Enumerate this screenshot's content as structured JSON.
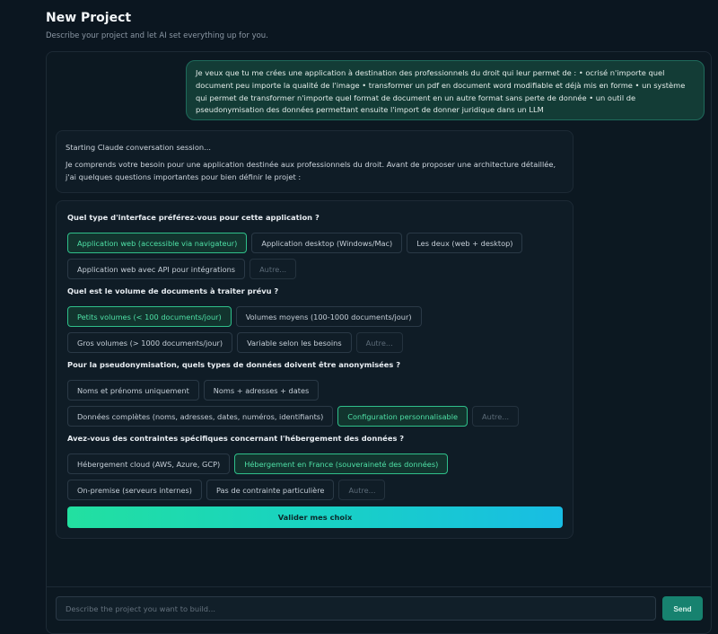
{
  "header": {
    "title": "New Project",
    "subtitle": "Describe your project and let AI set everything up for you."
  },
  "user_message": "Je veux que tu me crées une application à destination des professionnels du droit qui leur permet de : • ocrisé n'importe quel document peu importe la qualité de l'image • transformer un pdf en document word modifiable et déjà mis en forme • un système qui permet de transformer n'importe quel format de document en un autre format sans perte de donnée • un outil de pseudonymisation des données permettant ensuite l'import de donner juridique dans un LLM",
  "assistant_message": {
    "session": "Starting Claude conversation session...",
    "text": "Je comprends votre besoin pour une application destinée aux professionnels du droit. Avant de proposer une architecture détaillée, j'ai quelques questions importantes pour bien définir le projet :"
  },
  "questions": [
    {
      "label": "Quel type d'interface préférez-vous pour cette application ?",
      "row1": [
        "Application web (accessible via navigateur)",
        "Application desktop (Windows/Mac)",
        "Les deux (web + desktop)"
      ],
      "row2": [
        "Application web avec API pour intégrations",
        "Autre..."
      ]
    },
    {
      "label": "Quel est le volume de documents à traiter prévu ?",
      "row1": [
        "Petits volumes (< 100 documents/jour)",
        "Volumes moyens (100-1000 documents/jour)"
      ],
      "row2": [
        "Gros volumes (> 1000 documents/jour)",
        "Variable selon les besoins",
        "Autre..."
      ]
    },
    {
      "label": "Pour la pseudonymisation, quels types de données doivent être anonymisées ?",
      "row1": [
        "Noms et prénoms uniquement",
        "Noms + adresses + dates"
      ],
      "row2": [
        "Données complètes (noms, adresses, dates, numéros, identifiants)",
        "Configuration personnalisable",
        "Autre..."
      ]
    },
    {
      "label": "Avez-vous des contraintes spécifiques concernant l'hébergement des données ?",
      "row1": [
        "Hébergement cloud (AWS, Azure, GCP)",
        "Hébergement en France (souveraineté des données)"
      ],
      "row2": [
        "On-premise (serveurs internes)",
        "Pas de contrainte particulière",
        "Autre..."
      ]
    }
  ],
  "validate_label": "Valider mes choix",
  "composer": {
    "placeholder": "Describe the project you want to build...",
    "send_label": "Send"
  },
  "colors": {
    "accent": "#2fbf8a",
    "user_bubble": "#133c36",
    "background": "#0b1620"
  }
}
